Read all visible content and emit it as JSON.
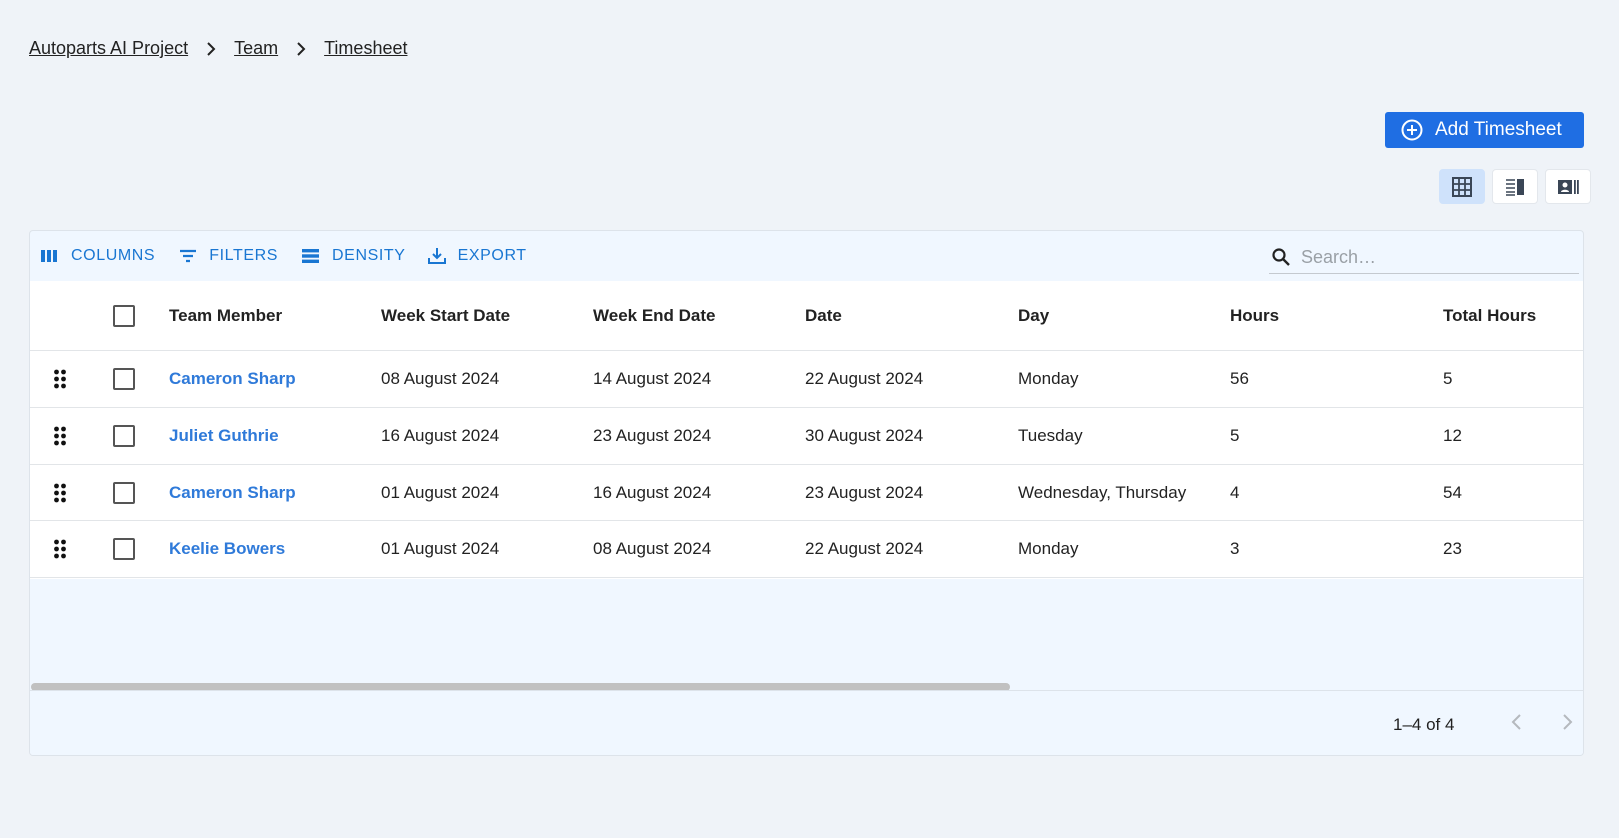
{
  "breadcrumb": {
    "items": [
      "Autoparts AI Project",
      "Team",
      "Timesheet"
    ]
  },
  "actions": {
    "add_label": "Add Timesheet"
  },
  "toolbar": {
    "columns": "COLUMNS",
    "filters": "FILTERS",
    "density": "DENSITY",
    "export": "EXPORT",
    "search_placeholder": "Search…"
  },
  "table": {
    "headers": [
      "Team Member",
      "Week Start Date",
      "Week End Date",
      "Date",
      "Day",
      "Hours",
      "Total Hours"
    ],
    "rows": [
      {
        "member": "Cameron Sharp",
        "week_start": "08 August 2024",
        "week_end": "14 August 2024",
        "date": "22 August 2024",
        "day": "Monday",
        "hours": "56",
        "total": "5"
      },
      {
        "member": "Juliet Guthrie",
        "week_start": "16 August 2024",
        "week_end": "23 August 2024",
        "date": "30 August 2024",
        "day": "Tuesday",
        "hours": "5",
        "total": "12"
      },
      {
        "member": "Cameron Sharp",
        "week_start": "01 August 2024",
        "week_end": "16 August 2024",
        "date": "23 August 2024",
        "day": "Wednesday, Thursday",
        "hours": "4",
        "total": "54"
      },
      {
        "member": "Keelie Bowers",
        "week_start": "01 August 2024",
        "week_end": "08 August 2024",
        "date": "22 August 2024",
        "day": "Monday",
        "hours": "3",
        "total": "23"
      }
    ]
  },
  "pagination": {
    "text": "1–4 of 4"
  },
  "colors": {
    "primary": "#1f6ee3",
    "link": "#2f7ad9",
    "toolbar_text": "#1976d2",
    "page_bg": "#eff3f8"
  }
}
